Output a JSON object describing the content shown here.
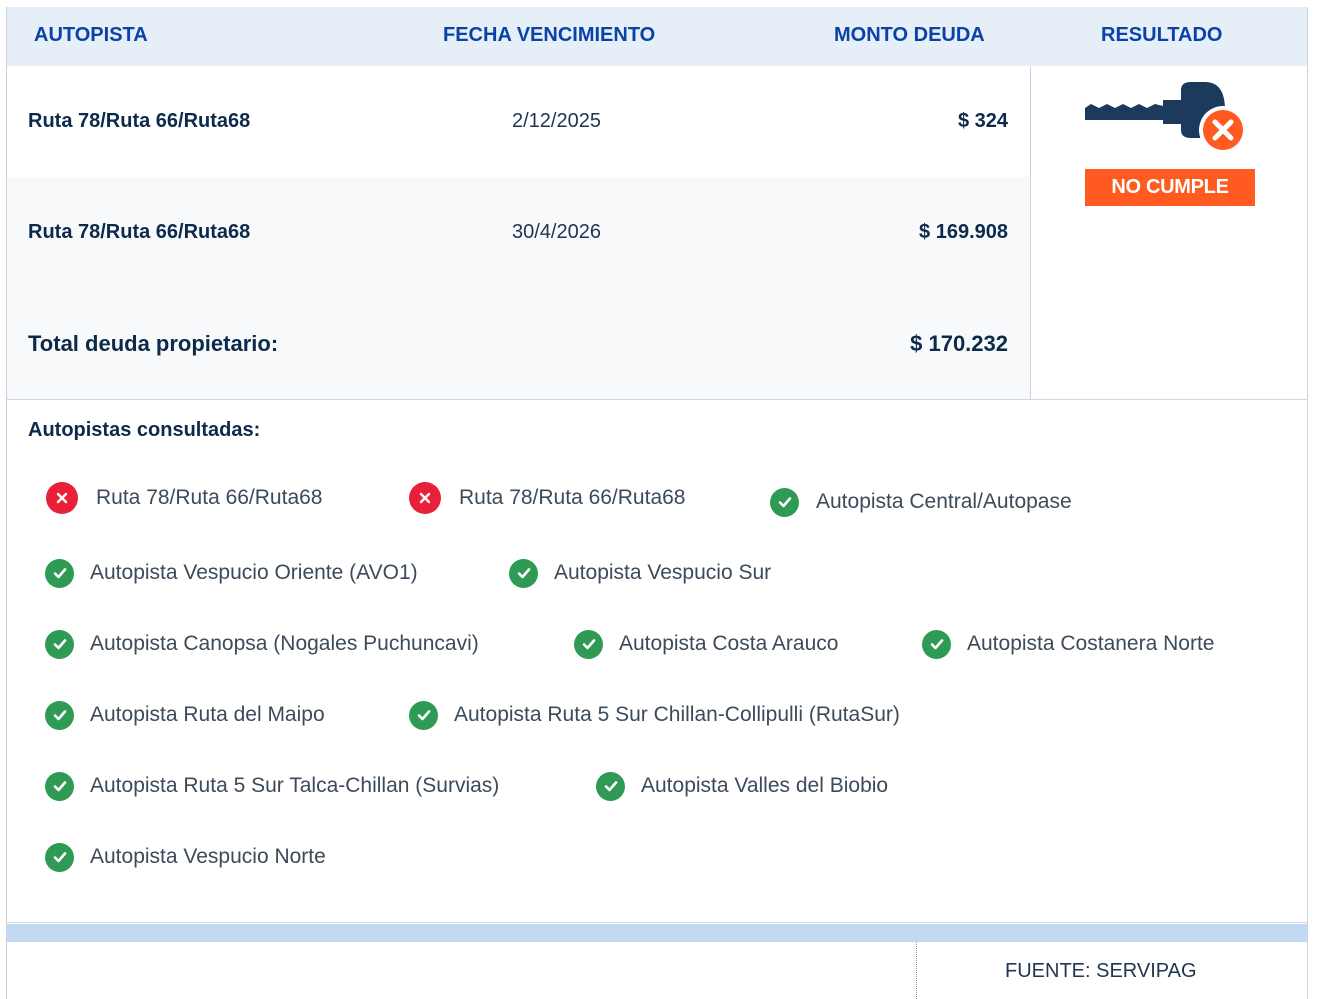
{
  "table": {
    "headers": {
      "autopista": "AUTOPISTA",
      "fecha": "FECHA VENCIMIENTO",
      "monto": "MONTO DEUDA",
      "resultado": "RESULTADO"
    },
    "rows": [
      {
        "autopista": "Ruta 78/Ruta 66/Ruta68",
        "fecha": "2/12/2025",
        "monto": "$ 324"
      },
      {
        "autopista": "Ruta 78/Ruta 66/Ruta68",
        "fecha": "30/4/2026",
        "monto": "$ 169.908"
      }
    ],
    "total": {
      "label": "Total deuda propietario:",
      "monto": "$ 170.232"
    }
  },
  "result": {
    "badge": "NO CUMPLE",
    "icon": "key-x-icon",
    "badge_color": "#ff5a1f",
    "key_color": "#1b3a5c"
  },
  "consultadas": {
    "title": "Autopistas consultadas:",
    "items": [
      {
        "label": "Ruta 78/Ruta 66/Ruta68",
        "status": "error"
      },
      {
        "label": "Ruta 78/Ruta 66/Ruta68",
        "status": "error"
      },
      {
        "label": "Autopista Central/Autopase",
        "status": "ok"
      },
      {
        "label": "Autopista Vespucio Oriente (AVO1)",
        "status": "ok"
      },
      {
        "label": "Autopista Vespucio Sur",
        "status": "ok"
      },
      {
        "label": "Autopista Canopsa (Nogales Puchuncavi)",
        "status": "ok"
      },
      {
        "label": "Autopista Costa Arauco",
        "status": "ok"
      },
      {
        "label": "Autopista Costanera Norte",
        "status": "ok"
      },
      {
        "label": "Autopista Ruta del Maipo",
        "status": "ok"
      },
      {
        "label": "Autopista Ruta 5 Sur Chillan-Collipulli (RutaSur)",
        "status": "ok"
      },
      {
        "label": "Autopista Ruta 5 Sur Talca-Chillan (Survias)",
        "status": "ok"
      },
      {
        "label": "Autopista Valles del Biobio",
        "status": "ok"
      },
      {
        "label": "Autopista Vespucio Norte",
        "status": "ok"
      }
    ]
  },
  "footer": {
    "fuente": "FUENTE: SERVIPAG"
  },
  "colors": {
    "header_text": "#0a43a8",
    "ok": "#2f9a53",
    "error": "#e8203a",
    "header_bg": "#e6eef8"
  }
}
